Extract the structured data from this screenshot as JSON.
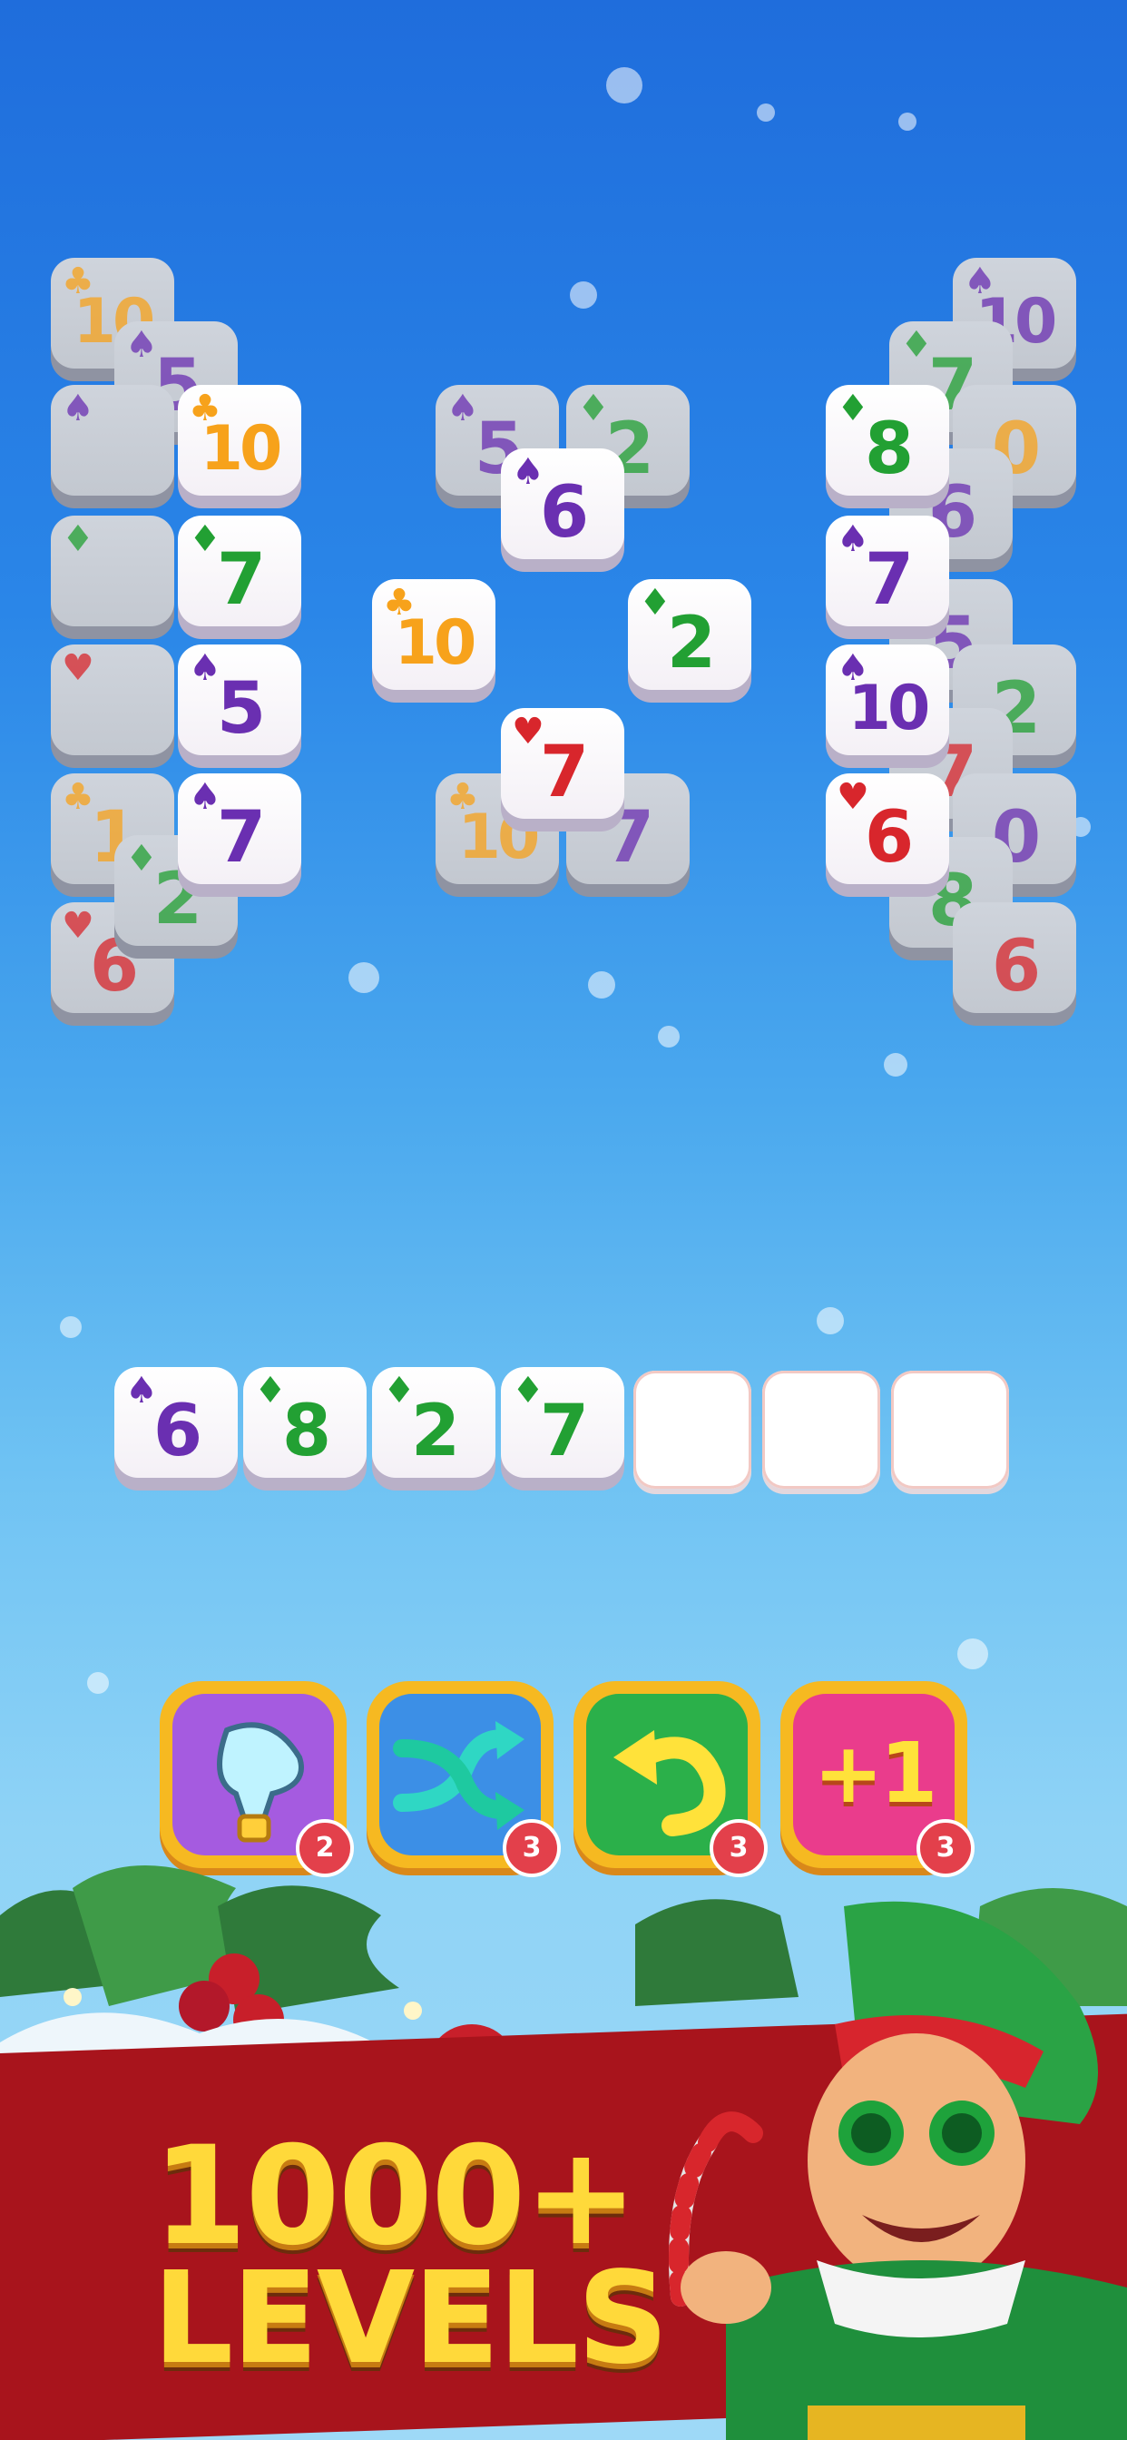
{
  "board": {
    "tiles": [
      {
        "rank": "10",
        "suit": "♣",
        "color": "#f7a21b",
        "dim": true,
        "pos": "c0"
      },
      {
        "rank": "5",
        "suit": "♠",
        "color": "#6a2fb1",
        "dim": true,
        "pos": "c1"
      },
      {
        "rank": "",
        "suit": "♠",
        "color": "#6a2fb1",
        "dim": true,
        "pos": "c2"
      },
      {
        "rank": "10",
        "suit": "♣",
        "color": "#f7a21b",
        "dim": false,
        "pos": "c3"
      },
      {
        "rank": "7",
        "suit": "♦",
        "color": "#22a033",
        "dim": false,
        "pos": "c4"
      },
      {
        "rank": "5",
        "suit": "♠",
        "color": "#6a2fb1",
        "dim": false,
        "pos": "c5"
      },
      {
        "rank": "7",
        "suit": "♠",
        "color": "#6a2fb1",
        "dim": false,
        "pos": "c6"
      },
      {
        "rank": "",
        "suit": "♦",
        "color": "#22a033",
        "dim": true,
        "pos": "c7"
      },
      {
        "rank": "",
        "suit": "♥",
        "color": "#d8262c",
        "dim": true,
        "pos": "c8"
      },
      {
        "rank": "1",
        "suit": "♣",
        "color": "#f7a21b",
        "dim": true,
        "pos": "c9"
      },
      {
        "rank": "6",
        "suit": "♥",
        "color": "#d8262c",
        "dim": true,
        "pos": "c10"
      },
      {
        "rank": "2",
        "suit": "♦",
        "color": "#22a033",
        "dim": true,
        "pos": "c11"
      },
      {
        "rank": "5",
        "suit": "♠",
        "color": "#6a2fb1",
        "dim": true,
        "pos": "m0"
      },
      {
        "rank": "2",
        "suit": "♦",
        "color": "#22a033",
        "dim": true,
        "pos": "m1"
      },
      {
        "rank": "6",
        "suit": "♠",
        "color": "#6a2fb1",
        "dim": false,
        "pos": "m2"
      },
      {
        "rank": "10",
        "suit": "♣",
        "color": "#f7a21b",
        "dim": false,
        "pos": "m3"
      },
      {
        "rank": "2",
        "suit": "♦",
        "color": "#22a033",
        "dim": false,
        "pos": "m4"
      },
      {
        "rank": "10",
        "suit": "♣",
        "color": "#f7a21b",
        "dim": true,
        "pos": "m5"
      },
      {
        "rank": "7",
        "suit": "♠",
        "color": "#6a2fb1",
        "dim": true,
        "pos": "m6"
      },
      {
        "rank": "7",
        "suit": "♥",
        "color": "#d8262c",
        "dim": false,
        "pos": "m7"
      },
      {
        "rank": "10",
        "suit": "♠",
        "color": "#6a2fb1",
        "dim": true,
        "pos": "r0"
      },
      {
        "rank": "7",
        "suit": "♦",
        "color": "#22a033",
        "dim": true,
        "pos": "r1"
      },
      {
        "rank": "0",
        "suit": "",
        "color": "#f7a21b",
        "dim": true,
        "pos": "r2"
      },
      {
        "rank": "6",
        "suit": "",
        "color": "#6a2fb1",
        "dim": true,
        "pos": "r3"
      },
      {
        "rank": "5",
        "suit": "",
        "color": "#6a2fb1",
        "dim": true,
        "pos": "r4"
      },
      {
        "rank": "2",
        "suit": "",
        "color": "#22a033",
        "dim": true,
        "pos": "r5"
      },
      {
        "rank": "7",
        "suit": "",
        "color": "#d8262c",
        "dim": true,
        "pos": "r6"
      },
      {
        "rank": "0",
        "suit": "",
        "color": "#6a2fb1",
        "dim": true,
        "pos": "r7"
      },
      {
        "rank": "8",
        "suit": "",
        "color": "#22a033",
        "dim": true,
        "pos": "r8"
      },
      {
        "rank": "6",
        "suit": "",
        "color": "#d8262c",
        "dim": true,
        "pos": "r9"
      },
      {
        "rank": "8",
        "suit": "♦",
        "color": "#22a033",
        "dim": false,
        "pos": "r10"
      },
      {
        "rank": "7",
        "suit": "♠",
        "color": "#6a2fb1",
        "dim": false,
        "pos": "r11"
      },
      {
        "rank": "10",
        "suit": "♠",
        "color": "#6a2fb1",
        "dim": false,
        "pos": "r12"
      },
      {
        "rank": "6",
        "suit": "♥",
        "color": "#d8262c",
        "dim": false,
        "pos": "r13"
      }
    ]
  },
  "tray": {
    "tiles": [
      {
        "rank": "6",
        "suit": "♠",
        "color": "#6a2fb1"
      },
      {
        "rank": "8",
        "suit": "♦",
        "color": "#22a033"
      },
      {
        "rank": "2",
        "suit": "♦",
        "color": "#22a033"
      },
      {
        "rank": "7",
        "suit": "♦",
        "color": "#22a033"
      }
    ],
    "empty_slots": 3
  },
  "boosters": [
    {
      "name": "hint",
      "icon": "lightbulb-icon",
      "count": "2",
      "color": "#a55be0"
    },
    {
      "name": "shuffle",
      "icon": "shuffle-icon",
      "count": "3",
      "color": "#3c8fe6"
    },
    {
      "name": "undo",
      "icon": "undo-icon",
      "count": "3",
      "color": "#2bb04a"
    },
    {
      "name": "extra-slot",
      "icon": "plus-one-icon",
      "count": "3",
      "color": "#ea3c8c",
      "label": "+1"
    }
  ],
  "promo": {
    "line1": "1000+",
    "line2": "LEVELS"
  }
}
